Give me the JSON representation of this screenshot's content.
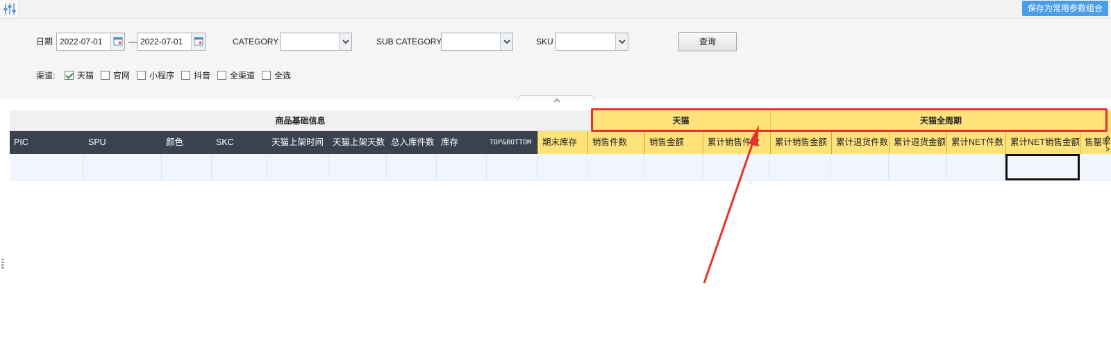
{
  "toolbar": {
    "save_combo_label": "保存为常用参数组合",
    "filter_toggle_icon": "sliders-icon"
  },
  "filters": {
    "date_label": "日期",
    "date_from": "2022-07-01",
    "date_to": "2022-07-01",
    "date_separator": "—",
    "category_label": "CATEGORY",
    "category_value": "",
    "subcategory_label": "SUB CATEGORY",
    "subcategory_value": "",
    "sku_label": "SKU",
    "sku_value": "",
    "query_label": "查询",
    "channel_label": "渠道:",
    "channels": [
      {
        "label": "天猫",
        "checked": true
      },
      {
        "label": "官网",
        "checked": false
      },
      {
        "label": "小程序",
        "checked": false
      },
      {
        "label": "抖音",
        "checked": false
      },
      {
        "label": "全渠道",
        "checked": false
      },
      {
        "label": "全选",
        "checked": false
      }
    ]
  },
  "table": {
    "groups": {
      "basic": "商品基础信息",
      "tmall": "天猫",
      "tmall_full_cycle": "天猫全周期"
    },
    "columns": [
      "PIC",
      "SPU",
      "颜色",
      "SKC",
      "天猫上架时间",
      "天猫上架天数",
      "总入库件数",
      "库存",
      "TOP&BOTTOM",
      "期末库存",
      "销售件数",
      "销售金额",
      "累计销售件数",
      "累计销售金额",
      "累计退货件数",
      "累计退货金额",
      "累计NET件数",
      "累计NET销售金额",
      "售罄率NET"
    ]
  },
  "colors": {
    "header_dark": "#3a4250",
    "header_yellow": "#ffe27a",
    "highlight_red": "#e8312a",
    "accent_blue": "#4a9ee8"
  }
}
